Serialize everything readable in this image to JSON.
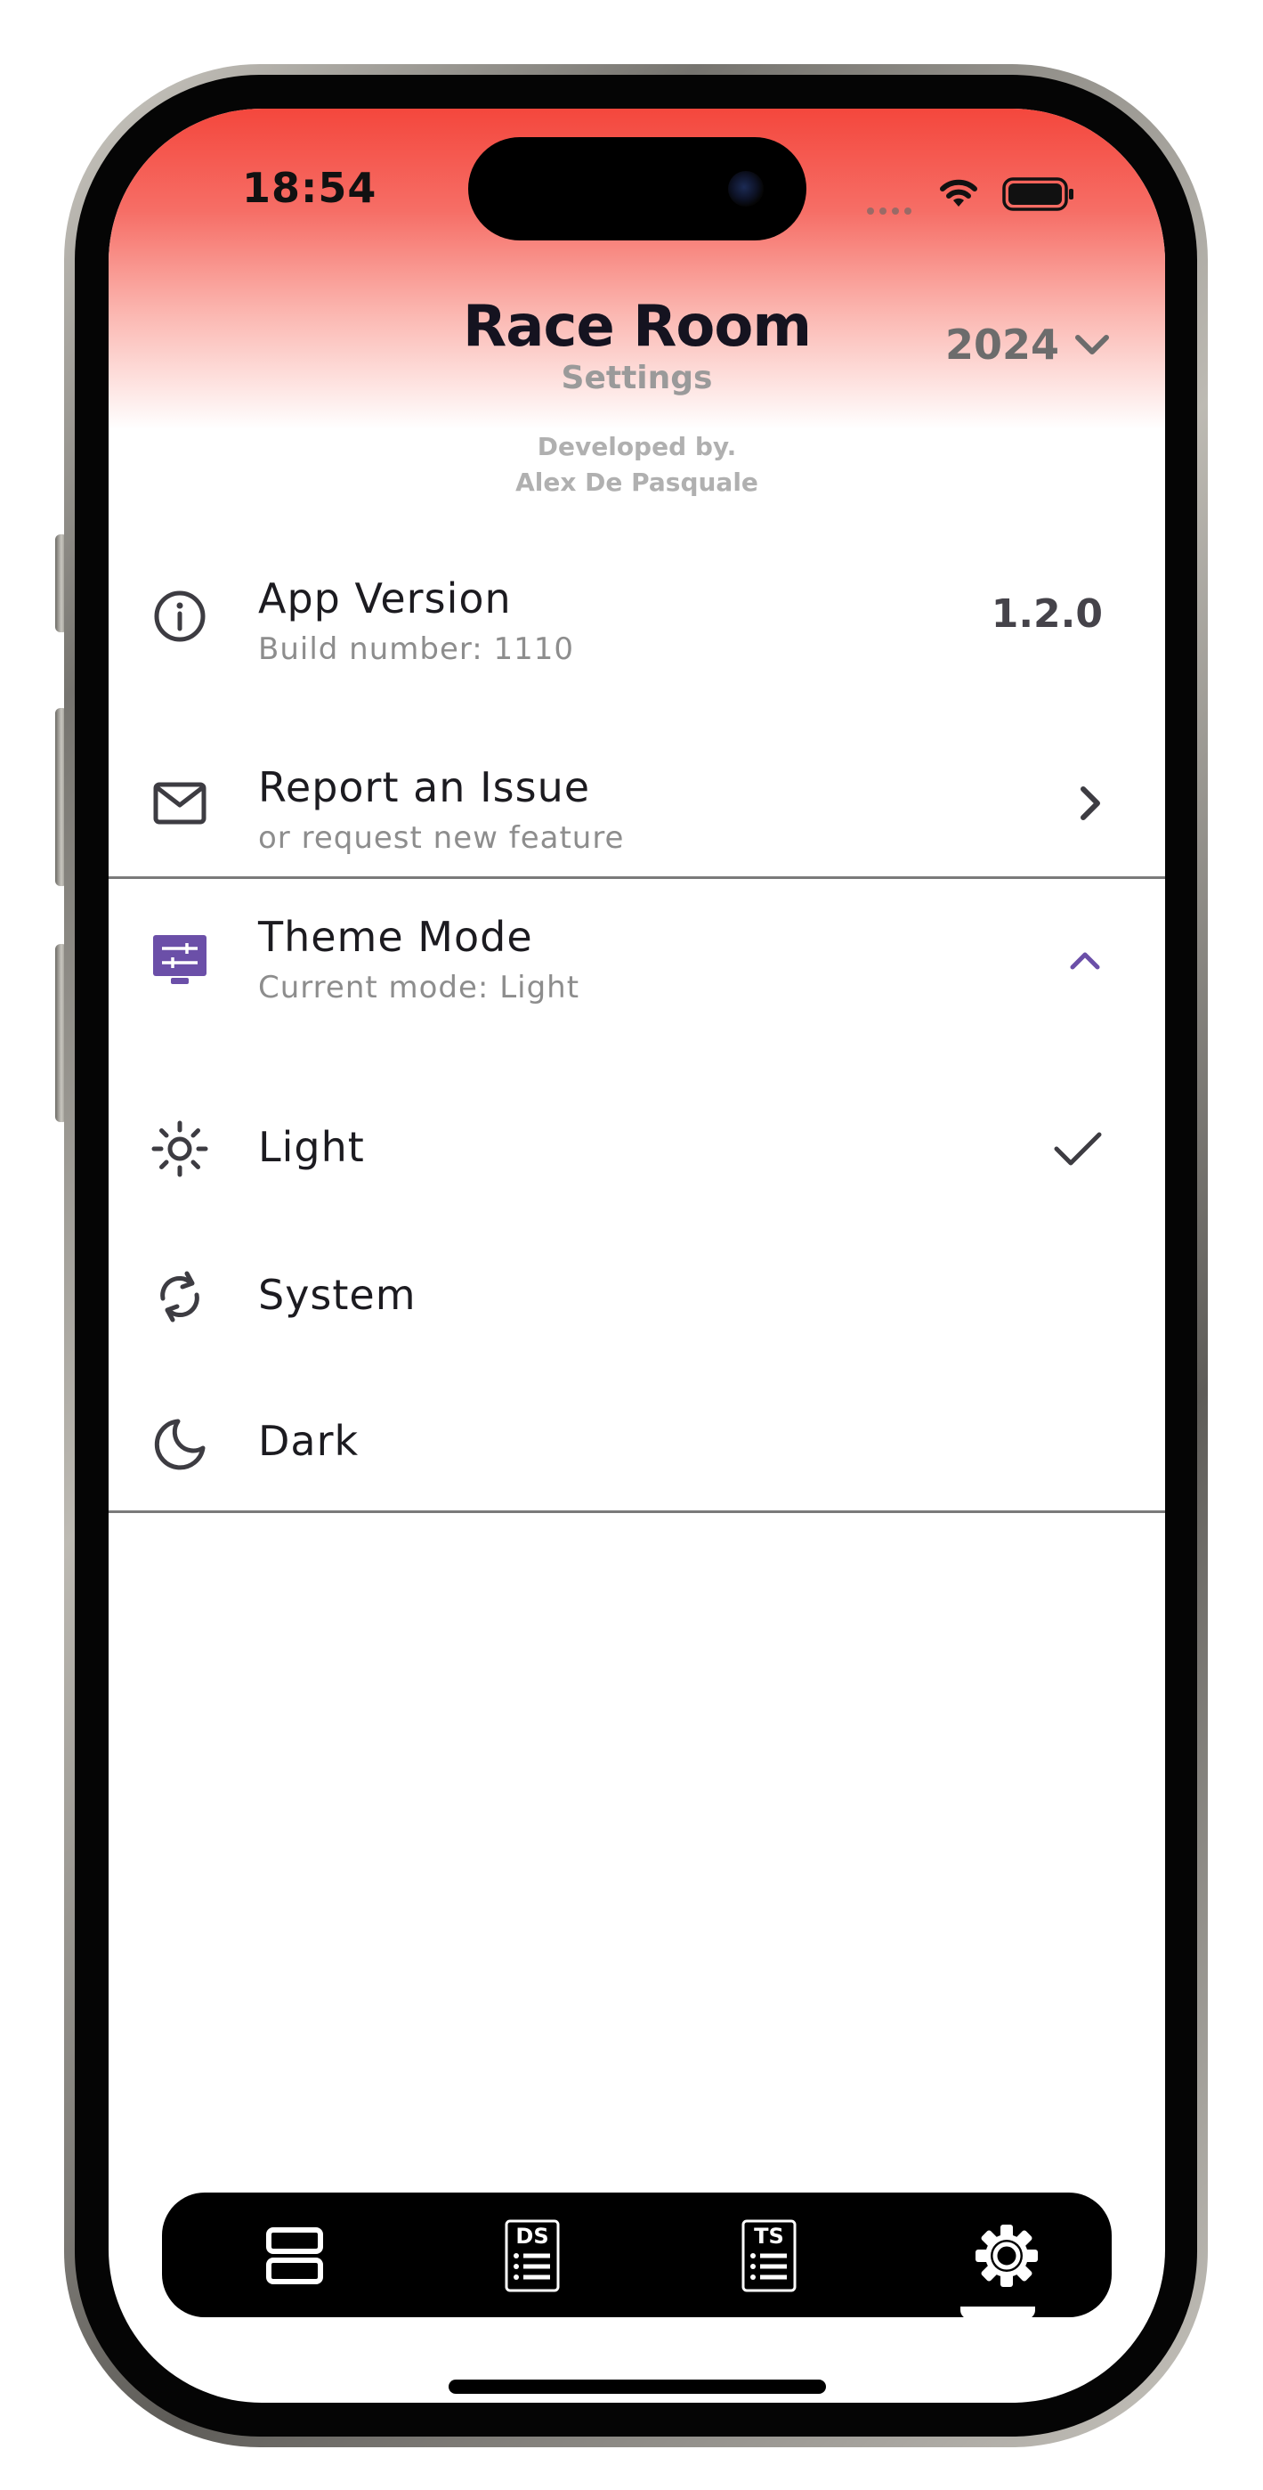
{
  "status_bar": {
    "time": "18:54"
  },
  "header": {
    "title": "Race Room",
    "subtitle": "Settings",
    "year": "2024",
    "developer_line1": "Developed by.",
    "developer_line2": "Alex De Pasquale"
  },
  "settings": {
    "app_version": {
      "title": "App Version",
      "subtitle": "Build number: 1110",
      "value": "1.2.0",
      "icon": "info-icon"
    },
    "report_issue": {
      "title": "Report an Issue",
      "subtitle": "or request new feature",
      "icon": "mail-icon"
    },
    "theme_mode": {
      "title": "Theme Mode",
      "subtitle": "Current mode: Light",
      "icon": "monitor-settings-icon",
      "expanded": true
    },
    "theme_options": [
      {
        "label": "Light",
        "icon": "sun-icon",
        "selected": true
      },
      {
        "label": "System",
        "icon": "sync-icon",
        "selected": false
      },
      {
        "label": "Dark",
        "icon": "moon-icon",
        "selected": false
      }
    ]
  },
  "tab_bar": {
    "tabs": [
      {
        "id": "races",
        "icon": "races-list-icon"
      },
      {
        "id": "driver-standings",
        "icon": "driver-standings-icon",
        "badge": "DS"
      },
      {
        "id": "team-standings",
        "icon": "team-standings-icon",
        "badge": "TS"
      },
      {
        "id": "settings",
        "icon": "settings-gear-icon",
        "active": true
      }
    ]
  },
  "colors": {
    "accent": "#6b4fa8",
    "header_red": "#f4473d",
    "text_dark": "#1c1b20",
    "text_muted": "#8d8d8d"
  }
}
